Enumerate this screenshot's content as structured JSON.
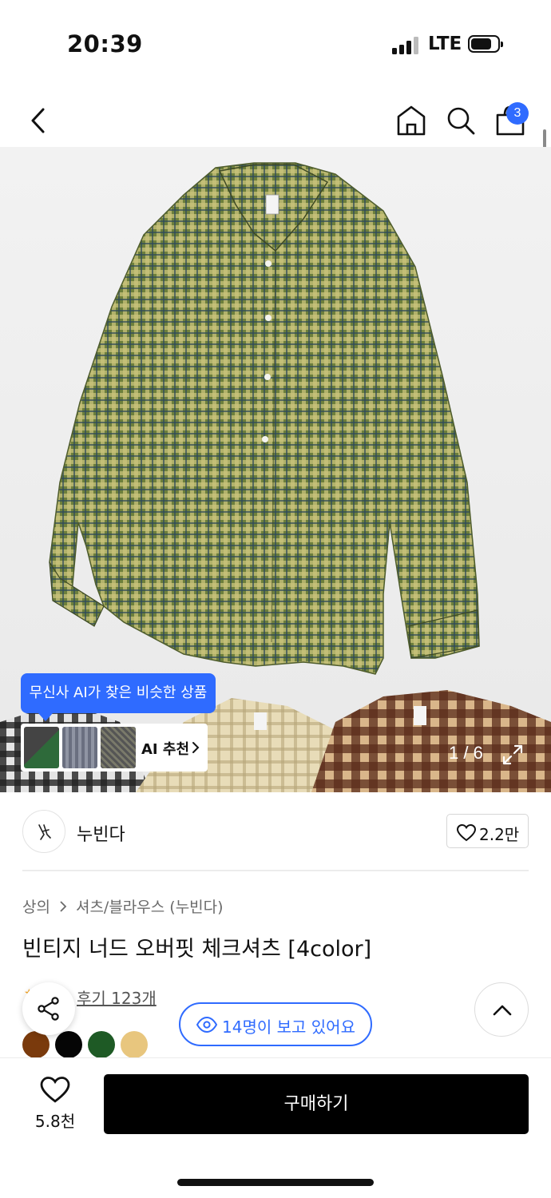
{
  "status_bar": {
    "time": "20:39",
    "network": "LTE"
  },
  "nav": {
    "cart_count": "3"
  },
  "gallery": {
    "ai_tooltip": "무신사 AI가 찾은 비슷한 상품",
    "ai_label": "AI 추천",
    "page_counter": "1 / 6"
  },
  "brand": {
    "name": "누빈다",
    "likes": "2.2만"
  },
  "product": {
    "breadcrumb": [
      "상의",
      "셔츠/블라우스 (누빈다)"
    ],
    "title": "빈티지 너드 오버핏 체크셔츠 [4color]",
    "reviews": "후기 123개",
    "swatches": [
      "#7a3a0c",
      "#050505",
      "#1e5a25",
      "#e8c67e"
    ]
  },
  "viewers": "14명이 보고 있어요",
  "bottom": {
    "wish_count": "5.8천",
    "buy_label": "구매하기"
  },
  "colors": {
    "accent": "#2f6bff",
    "buy": "#000000"
  },
  "icons": [
    "back-icon",
    "home-icon",
    "search-icon",
    "bag-icon",
    "expand-icon",
    "heart-icon",
    "share-icon",
    "eye-icon",
    "chevron-up-icon"
  ]
}
